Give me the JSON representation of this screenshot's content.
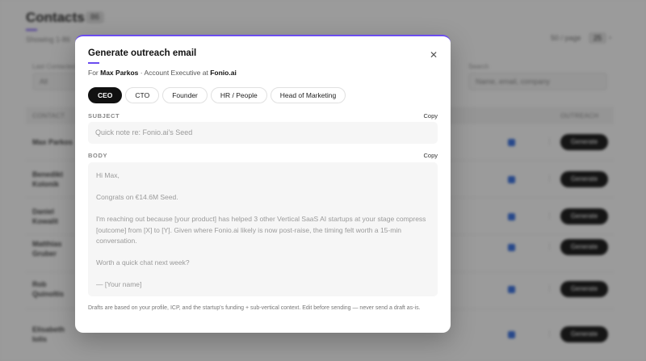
{
  "background": {
    "page_title": "Contacts",
    "count_badge": "86",
    "subtitle": "Showing 1-86",
    "per_page_label": "50 / page",
    "per_page_value": "25",
    "filters": [
      {
        "label": "Last Contacted",
        "value": "All"
      },
      {
        "label": "Search",
        "value": "Name, email, company"
      }
    ],
    "columns": [
      "CONTACT",
      "OUTREACH"
    ],
    "rows": [
      {
        "name": "Max Parkos",
        "action": "Generate"
      },
      {
        "name": "Benedikt Kolonik",
        "action": "Generate"
      },
      {
        "name": "Daniel Kowalit",
        "action": "Generate"
      },
      {
        "name": "Matthias Gruber",
        "action": "Generate"
      },
      {
        "name": "Rob Quinoltis",
        "action": "Generate"
      },
      {
        "name": "Elisabeth Iolis",
        "action": "Generate"
      }
    ]
  },
  "modal": {
    "title": "Generate outreach email",
    "for_prefix": "For",
    "contact_name": "Max Parkos",
    "contact_role": "· Account Executive at",
    "company": "Fonio.ai",
    "tabs": [
      {
        "label": "CEO",
        "active": true
      },
      {
        "label": "CTO",
        "active": false
      },
      {
        "label": "Founder",
        "active": false
      },
      {
        "label": "HR / People",
        "active": false
      },
      {
        "label": "Head of Marketing",
        "active": false
      }
    ],
    "subject_label": "SUBJECT",
    "subject_copy": "Copy",
    "subject_value": "Quick note re: Fonio.ai's Seed",
    "body_label": "BODY",
    "body_copy": "Copy",
    "body_value": "Hi Max,\n\nCongrats on €14.6M Seed.\n\nI'm reaching out because [your product] has helped 3 other Vertical SaaS AI startups at your stage compress [outcome] from [X] to [Y]. Given where Fonio.ai likely is now post-raise, the timing felt worth a 15-min conversation.\n\nWorth a quick chat next week?\n\n— [Your name]",
    "footnote": "Drafts are based on your profile, ICP, and the startup's funding + sub-vertical context. Edit before sending — never send a draft as-is."
  },
  "colors": {
    "accent": "#6b4cf0",
    "tab_active_bg": "#111111",
    "check_blue": "#3a6fd9"
  }
}
